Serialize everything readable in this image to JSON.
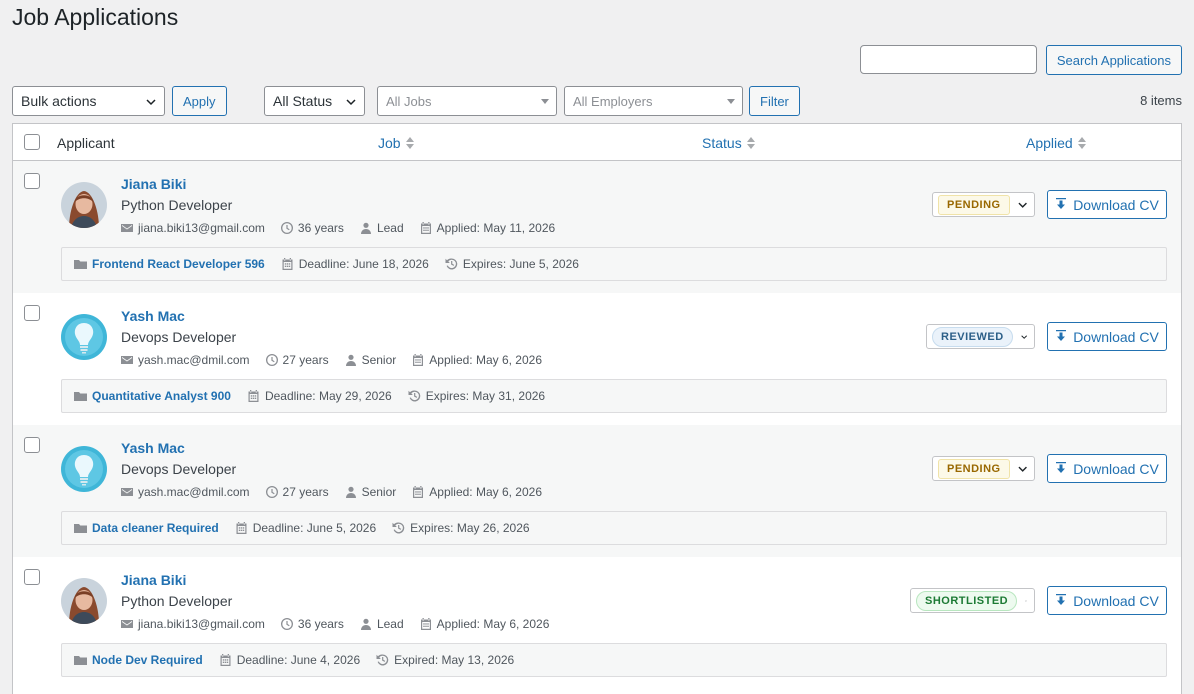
{
  "page": {
    "title": "Job Applications"
  },
  "search": {
    "placeholder": "",
    "button_label": "Search Applications"
  },
  "toolbar": {
    "bulk_actions": "Bulk actions",
    "apply_label": "Apply",
    "status_filter": "All Status",
    "jobs_filter": "All Jobs",
    "employers_filter": "All Employers",
    "filter_label": "Filter",
    "items_count": "8 items"
  },
  "table": {
    "columns": {
      "applicant": "Applicant",
      "job": "Job",
      "status": "Status",
      "applied": "Applied"
    },
    "download_label": "Download CV",
    "rows": [
      {
        "name": "Jiana Biki",
        "role": "Python Developer",
        "email": "jiana.biki13@gmail.com",
        "age": "36 years",
        "level": "Lead",
        "applied": "Applied: May 11, 2026",
        "status": "PENDING",
        "status_type": "pending",
        "job": "Frontend React Developer 596",
        "deadline": "Deadline: June 18, 2026",
        "expires": "Expires: June 5, 2026",
        "avatar": "woman"
      },
      {
        "name": "Yash Mac",
        "role": "Devops Developer",
        "email": "yash.mac@dmil.com",
        "age": "27 years",
        "level": "Senior",
        "applied": "Applied: May 6, 2026",
        "status": "REVIEWED",
        "status_type": "reviewed",
        "job": "Quantitative Analyst 900",
        "deadline": "Deadline: May 29, 2026",
        "expires": "Expires: May 31, 2026",
        "avatar": "bulb"
      },
      {
        "name": "Yash Mac",
        "role": "Devops Developer",
        "email": "yash.mac@dmil.com",
        "age": "27 years",
        "level": "Senior",
        "applied": "Applied: May 6, 2026",
        "status": "PENDING",
        "status_type": "pending",
        "job": "Data cleaner Required",
        "deadline": "Deadline: June 5, 2026",
        "expires": "Expires: May 26, 2026",
        "avatar": "bulb"
      },
      {
        "name": "Jiana Biki",
        "role": "Python Developer",
        "email": "jiana.biki13@gmail.com",
        "age": "36 years",
        "level": "Lead",
        "applied": "Applied: May 6, 2026",
        "status": "SHORTLISTED",
        "status_type": "shortlisted",
        "job": "Node Dev Required",
        "deadline": "Deadline: June 4, 2026",
        "expires": "Expired: May 13, 2026",
        "avatar": "woman"
      }
    ]
  }
}
